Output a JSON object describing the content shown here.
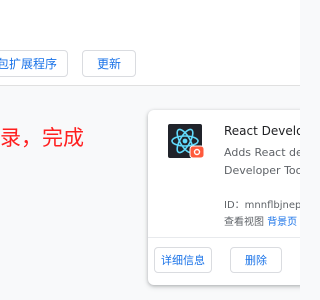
{
  "toolbar": {
    "pack_button_label": "包扩展程序",
    "update_button_label": "更新"
  },
  "note": {
    "text": "录，完成"
  },
  "extension_card": {
    "name": "React Developer",
    "description_line1": "Adds React deb",
    "description_line2": "Developer Tools",
    "id_text": "ID：mnnflbjnep",
    "views_label": "查看视图",
    "views_link": "背景页",
    "details_button_label": "详细信息",
    "remove_button_label": "删除",
    "icon_colors": {
      "background": "#20232a",
      "atom": "#61dafb",
      "badge": "#ff5a3c"
    }
  },
  "colors": {
    "accent": "#1a73e8",
    "note_red": "#ff1f1f"
  }
}
